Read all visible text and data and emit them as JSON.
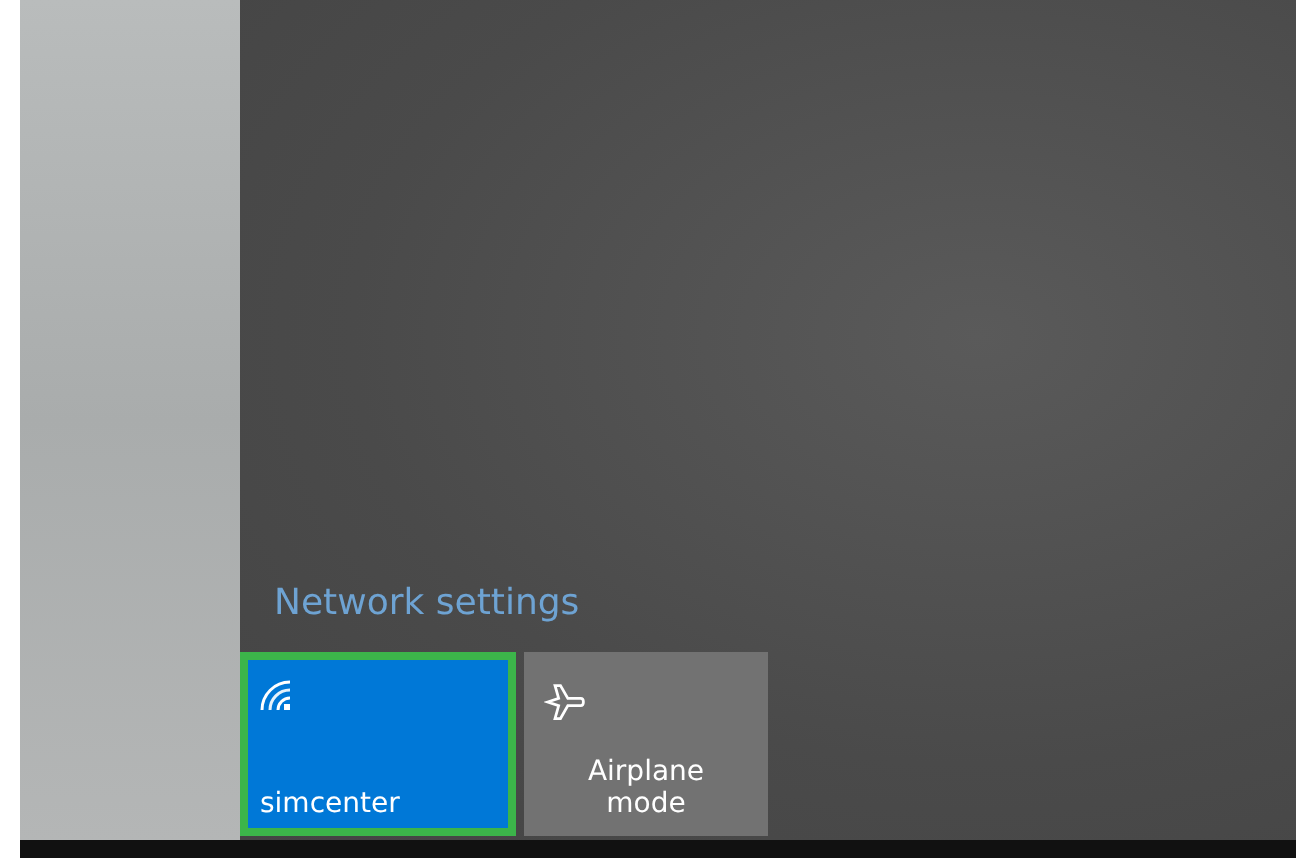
{
  "network_settings_link": "Network settings",
  "tiles": [
    {
      "kind": "wifi",
      "label": "simcenter",
      "on": true,
      "highlighted": true
    },
    {
      "kind": "airplane",
      "label": "Airplane mode",
      "on": false,
      "highlighted": false
    }
  ]
}
